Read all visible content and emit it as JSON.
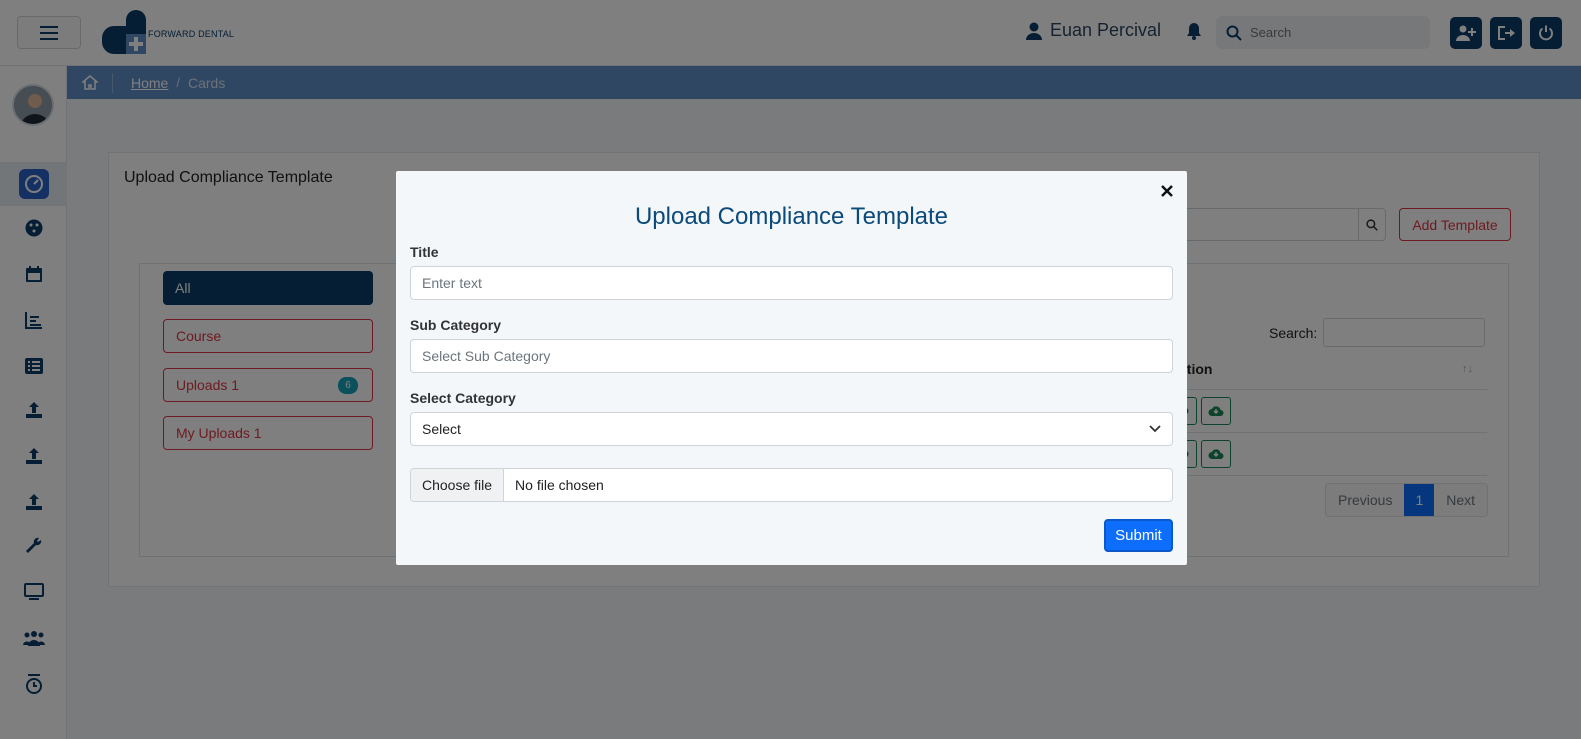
{
  "header": {
    "logo_text": "FORWARD DENTAL",
    "user_name": "Euan Percival",
    "search_placeholder": "Search"
  },
  "breadcrumb": {
    "home": "Home",
    "current": "Cards"
  },
  "card": {
    "title": "Upload Compliance Template",
    "add_button": "Add Template",
    "tabs": [
      {
        "label": "All"
      },
      {
        "label": "Course"
      },
      {
        "label": "Uploads 1",
        "badge": "6"
      },
      {
        "label": "My Uploads 1"
      }
    ],
    "table": {
      "search_label": "Search:",
      "action_header": "ction",
      "pager": {
        "previous": "Previous",
        "page": "1",
        "next": "Next"
      }
    }
  },
  "modal": {
    "title": "Upload Compliance Template",
    "fields": {
      "title_label": "Title",
      "title_placeholder": "Enter text",
      "subcategory_label": "Sub Category",
      "subcategory_placeholder": "Select Sub Category",
      "category_label": "Select Category",
      "category_value": "Select",
      "file_button": "Choose file",
      "file_status": "No file chosen"
    },
    "submit": "Submit"
  },
  "colors": {
    "brand": "#0b3c68",
    "accent": "#0d6efd",
    "danger": "#dc3545",
    "breadcrumb_bar": "#5f8fc6"
  }
}
